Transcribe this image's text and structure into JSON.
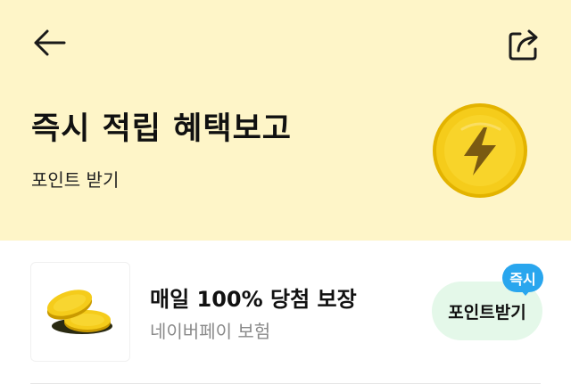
{
  "header": {
    "title": "즉시 적립 혜택보고",
    "subtitle": "포인트 받기",
    "icons": {
      "back": "arrow-left-icon",
      "share": "share-icon",
      "hero": "lightning-coin-icon"
    }
  },
  "offer": {
    "title": "매일 100% 당첨 보장",
    "provider": "네이버페이 보험",
    "button_label": "포인트받기",
    "badge": "즉시",
    "thumbnail": "gold-coins-icon"
  },
  "colors": {
    "hero_background": "#fef5c8",
    "coin_gold": "#f5cc1b",
    "button_background": "#e4f8e9",
    "badge_blue": "#29a6ee"
  }
}
